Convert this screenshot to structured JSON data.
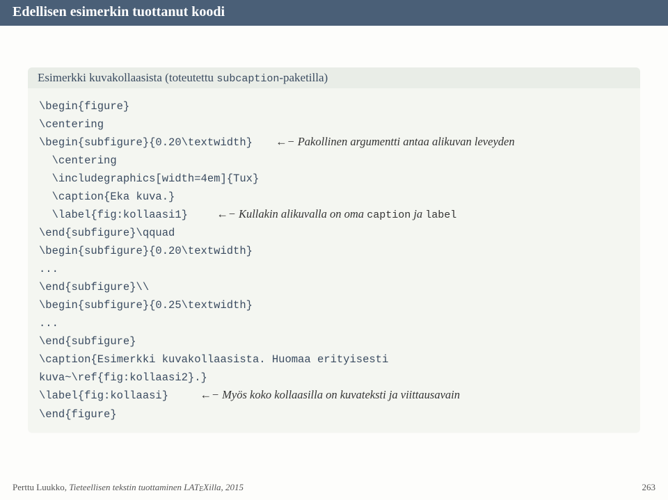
{
  "title": "Edellisen esimerkin tuottanut koodi",
  "example": {
    "heading_pre": "Esimerkki kuvakollaasista (toteutettu ",
    "heading_pkg": "subcaption",
    "heading_post": "-paketilla)",
    "l1": "\\begin{figure}",
    "l2": "\\centering",
    "l3a": "\\begin{subfigure}{0.20\\textwidth}",
    "l3arrow": "←−",
    "l3c": "Pakollinen argumentti antaa alikuvan leveyden",
    "l4": "  \\centering",
    "l5": "  \\includegraphics[width=4em]{Tux}",
    "l6": "  \\caption{Eka kuva.}",
    "l7a": "  \\label{fig:kollaasi1}",
    "l7arrow": "←−",
    "l7c_pre": "Kullakin alikuvalla on oma ",
    "l7c_code1": "caption",
    "l7c_mid": " ja ",
    "l7c_code2": "label",
    "l8": "\\end{subfigure}\\qquad",
    "l9": "\\begin{subfigure}{0.20\\textwidth}",
    "l10": "...",
    "l11": "\\end{subfigure}\\\\",
    "l12": "\\begin{subfigure}{0.25\\textwidth}",
    "l13": "...",
    "l14": "\\end{subfigure}",
    "l15": "\\caption{Esimerkki kuvakollaasista. Huomaa erityisesti",
    "l16": "kuva~\\ref{fig:kollaasi2}.}",
    "l17a": "\\label{fig:kollaasi}",
    "l17arrow": "←−",
    "l17c": "Myös koko kollaasilla on kuvateksti ja viittausavain",
    "l18": "\\end{figure}"
  },
  "footer": {
    "left_author": "Perttu Luukko, ",
    "left_title": "Tieteellisen tekstin tuottaminen LAT",
    "left_title2": "Xilla, 2015",
    "e": "E",
    "page": "263"
  }
}
